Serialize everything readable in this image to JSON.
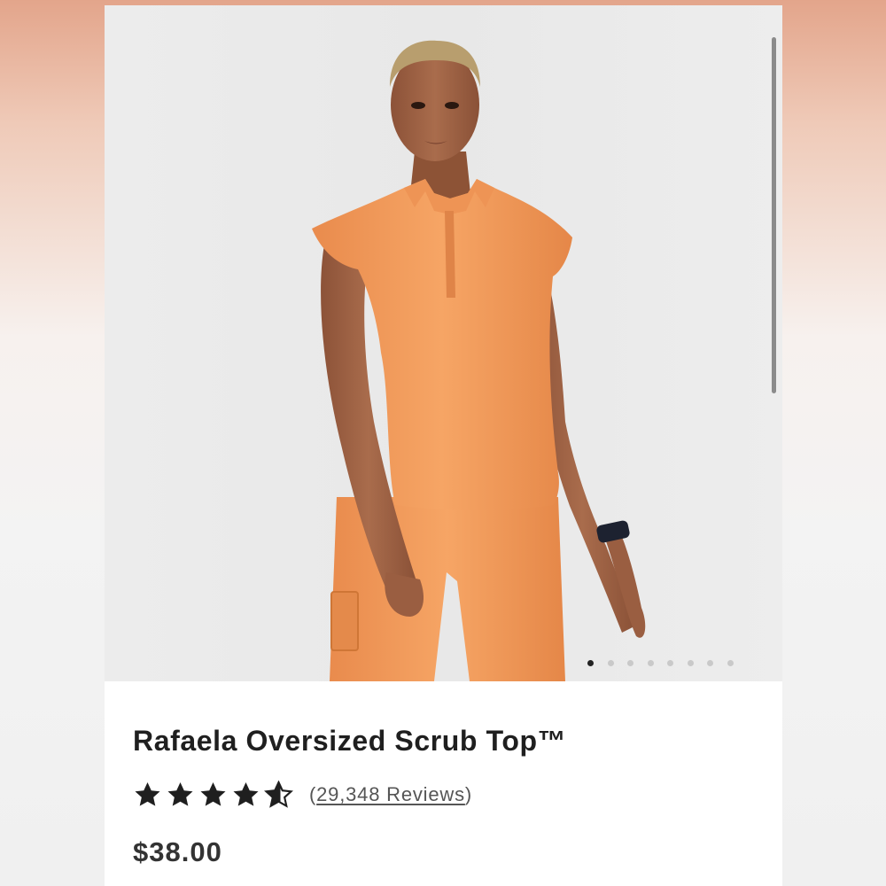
{
  "product": {
    "title": "Rafaela Oversized Scrub Top™",
    "rating": 4.5,
    "reviews_open": "(",
    "reviews_link": "29,348 Reviews",
    "reviews_close": ")",
    "price": "$38.00"
  },
  "gallery": {
    "image": "woman-wearing-orange-scrub-top-and-pants",
    "slide_count": 8,
    "active_slide": 1
  },
  "colors": {
    "scrub": "#f4a063",
    "skin": "#a4684a",
    "text": "#1f1f1f",
    "star": "#1f1f1f"
  }
}
